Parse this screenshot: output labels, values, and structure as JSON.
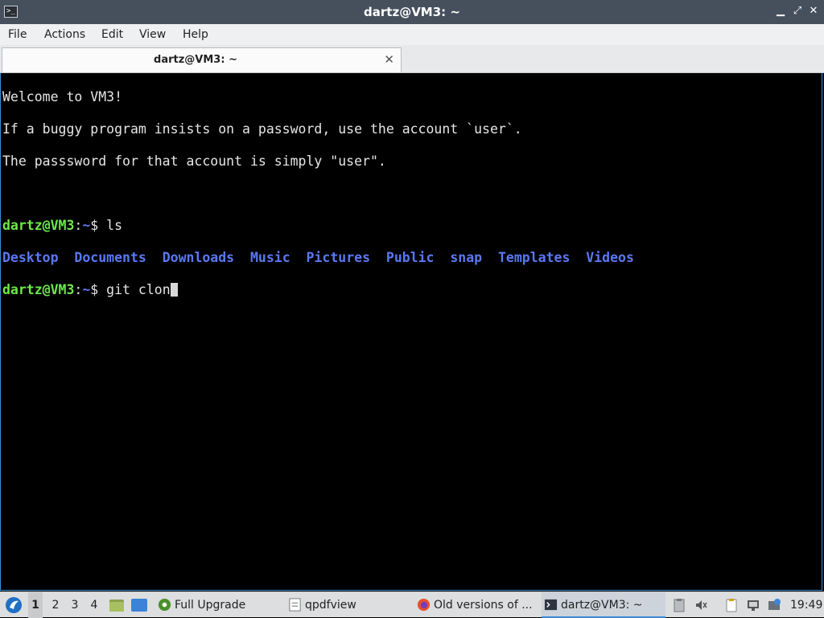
{
  "window": {
    "title": "dartz@VM3: ~",
    "app_icon_glyph": ">_",
    "buttons": {
      "minimize": "▁",
      "maximize": "⤢",
      "close": "✕"
    }
  },
  "menu": [
    "File",
    "Actions",
    "Edit",
    "View",
    "Help"
  ],
  "tab": {
    "label": "dartz@VM3: ~",
    "close": "✕"
  },
  "terminal": {
    "welcome": [
      "Welcome to VM3!",
      "If a buggy program insists on a password, use the account `user`.",
      "The passsword for that account is simply \"user\"."
    ],
    "prompt_user": "dartz@VM3",
    "prompt_colon": ":",
    "prompt_path": "~",
    "prompt_dollar": "$ ",
    "cmd1": "ls",
    "dirs": [
      "Desktop",
      "Documents",
      "Downloads",
      "Music",
      "Pictures",
      "Public",
      "snap",
      "Templates",
      "Videos"
    ],
    "cmd2": "git clon"
  },
  "taskbar": {
    "workspaces": [
      "1",
      "2",
      "3",
      "4"
    ],
    "tasks": [
      {
        "label": "Full Upgrade",
        "icon": "gear-icon"
      },
      {
        "label": "qpdfview",
        "icon": "pdf-icon"
      },
      {
        "label": "Old versions of ...",
        "icon": "firefox-icon"
      },
      {
        "label": "dartz@VM3: ~",
        "icon": "terminal-icon"
      }
    ],
    "clock": "19:49"
  },
  "colors": {
    "prompt_green": "#6ee84a",
    "dir_blue": "#5a78f2",
    "titlebar": "#46505d",
    "accent": "#3d86d6"
  }
}
